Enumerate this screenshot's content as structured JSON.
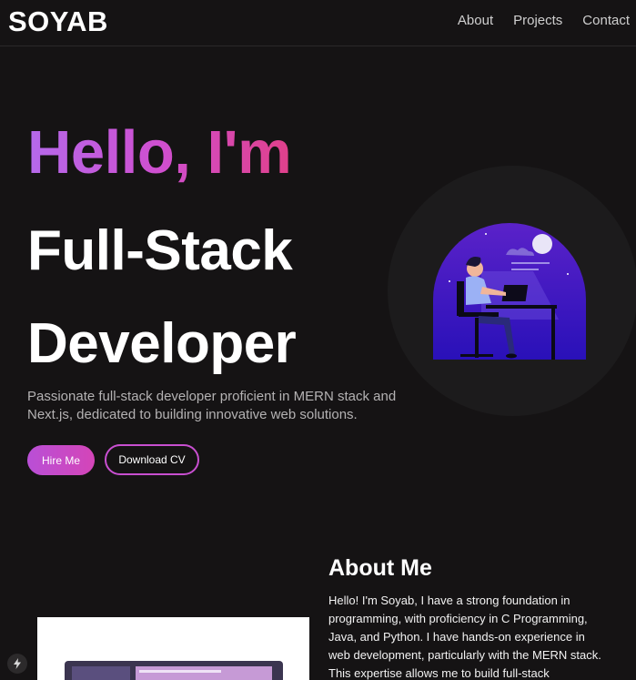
{
  "nav": {
    "brand": "SOYAB",
    "links": [
      "About",
      "Projects",
      "Contact"
    ]
  },
  "hero": {
    "greeting": "Hello, I'm",
    "role_line1": "Full-Stack",
    "role_line2": "Developer",
    "tagline": "Passionate full-stack developer proficient in MERN stack and Next.js, dedicated to building innovative web solutions.",
    "hire_label": "Hire Me",
    "cv_label": "Download CV"
  },
  "about": {
    "title": "About Me",
    "text": "Hello! I'm Soyab, I have a strong foundation in programming, with proficiency in C Programming, Java, and Python. I have hands-on experience in web development, particularly with the MERN stack. This expertise allows me to build full-stack"
  },
  "icons": {
    "hero": "developer-at-desk-illustration",
    "badge": "lightning-icon"
  },
  "colors": {
    "background": "#151314",
    "accent_purple": "#b569ea",
    "accent_pink": "#e0408a"
  }
}
